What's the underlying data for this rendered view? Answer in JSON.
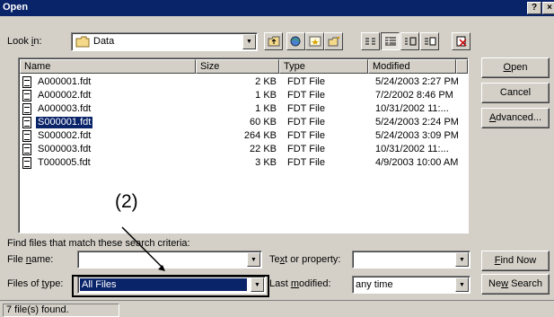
{
  "window": {
    "title": "Open",
    "help_label": "?",
    "close_label": "×"
  },
  "look_in": {
    "label_pre": "Look ",
    "label_u": "i",
    "label_post": "n:",
    "value": "Data"
  },
  "toolbar": {
    "buttons": [
      "up-folder",
      "search-web",
      "favorites",
      "new-folder",
      "list-view",
      "details-view",
      "properties-view",
      "preview-view",
      "delete"
    ]
  },
  "list": {
    "columns": [
      "Name",
      "Size",
      "Type",
      "Modified"
    ],
    "rows": [
      {
        "name": "A000001.fdt",
        "size": "2 KB",
        "type": "FDT File",
        "modified": "5/24/2003 2:27 PM"
      },
      {
        "name": "A000002.fdt",
        "size": "1 KB",
        "type": "FDT File",
        "modified": "7/2/2002 8:46 PM"
      },
      {
        "name": "A000003.fdt",
        "size": "1 KB",
        "type": "FDT File",
        "modified": "10/31/2002 11:..."
      },
      {
        "name": "S000001.fdt",
        "size": "60 KB",
        "type": "FDT File",
        "modified": "5/24/2003 2:24 PM",
        "selected": true
      },
      {
        "name": "S000002.fdt",
        "size": "264 KB",
        "type": "FDT File",
        "modified": "5/24/2003 3:09 PM"
      },
      {
        "name": "S000003.fdt",
        "size": "22 KB",
        "type": "FDT File",
        "modified": "10/31/2002 11:..."
      },
      {
        "name": "T000005.fdt",
        "size": "3 KB",
        "type": "FDT File",
        "modified": "4/9/2003 10:00 AM"
      }
    ]
  },
  "buttons": {
    "open": {
      "pre": "",
      "u": "O",
      "post": "pen"
    },
    "cancel": "Cancel",
    "advanced": {
      "pre": "",
      "u": "A",
      "post": "dvanced..."
    },
    "find_now": {
      "pre": "",
      "u": "F",
      "post": "ind Now"
    },
    "new_search": {
      "pre": "Ne",
      "u": "w",
      "post": " Search"
    }
  },
  "criteria": {
    "heading": "Find files that match these search criteria:",
    "file_name": {
      "pre": "File ",
      "u": "n",
      "post": "ame:",
      "value": ""
    },
    "files_of_type": {
      "pre": "Files of ",
      "u": "t",
      "post": "ype:",
      "value": "All Files"
    },
    "text_or_property": {
      "pre": "Te",
      "u": "x",
      "post": "t or property:",
      "value": ""
    },
    "last_modified": {
      "pre": "Last ",
      "u": "m",
      "post": "odified:",
      "value": "any time"
    }
  },
  "status": {
    "text": "7 file(s) found."
  },
  "annotation": {
    "label": "(2)"
  }
}
